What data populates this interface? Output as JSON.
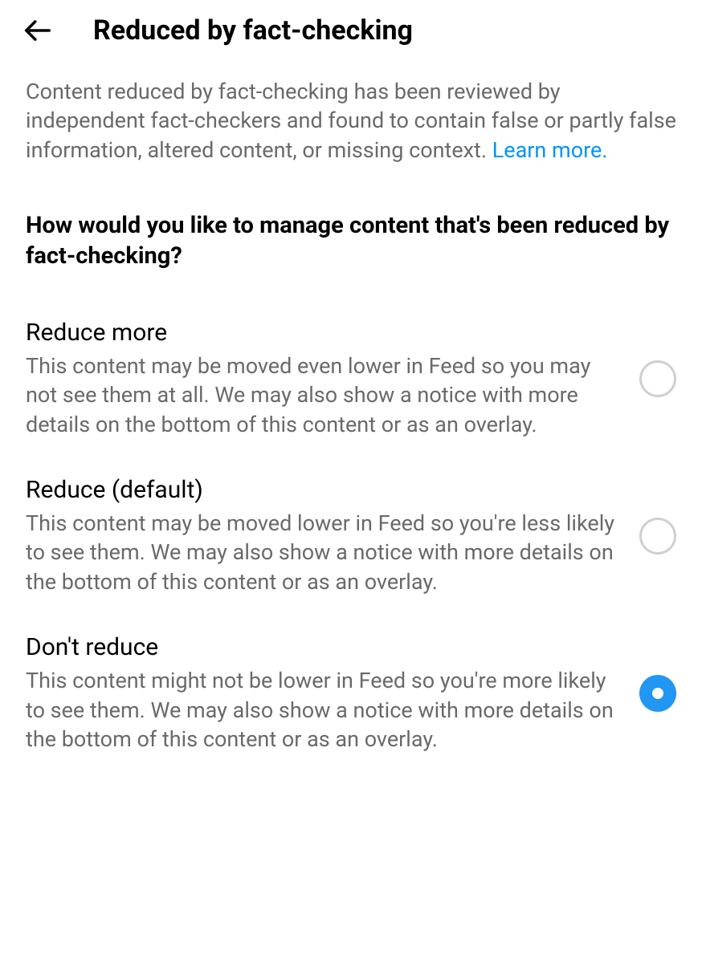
{
  "header": {
    "title": "Reduced by fact-checking"
  },
  "description": {
    "text": "Content reduced by fact-checking has been reviewed by independent fact-checkers and found to contain false or partly false information, altered content, or missing context. ",
    "learn_more": "Learn more."
  },
  "question": "How would you like to manage content that's been reduced by fact-checking?",
  "options": [
    {
      "title": "Reduce more",
      "description": "This content may be moved even lower in Feed so you may not see them at all. We may also show a notice with more details on the bottom of this content or as an overlay.",
      "selected": false
    },
    {
      "title": "Reduce (default)",
      "description": "This content may be moved lower in Feed so you're less likely to see them. We may also show a notice with more details on the bottom of this content or as an overlay.",
      "selected": false
    },
    {
      "title": "Don't reduce",
      "description": "This content might not be lower in Feed so you're more likely to see them. We may also show a notice with more details on the bottom of this content or as an overlay.",
      "selected": true
    }
  ]
}
